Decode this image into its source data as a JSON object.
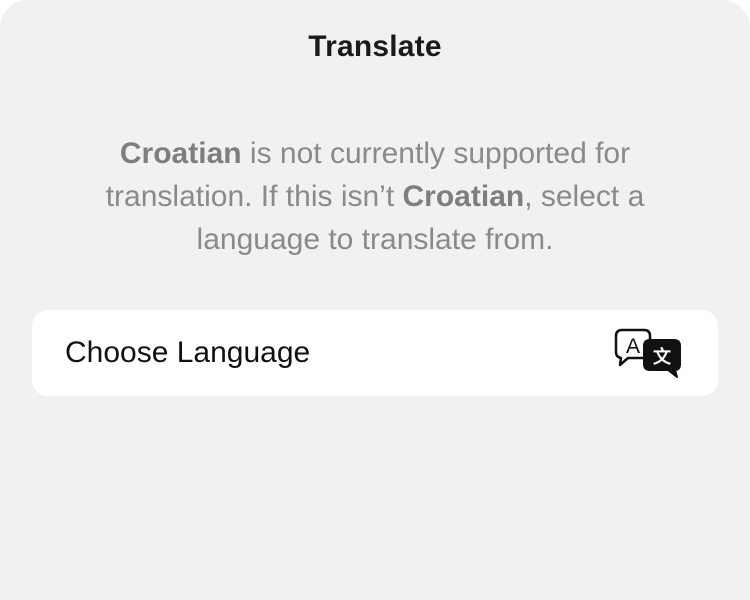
{
  "sheet": {
    "title": "Translate"
  },
  "message": {
    "lang_1": "Croatian",
    "text_1": " is not currently supported for translation. If this isn’t ",
    "lang_2": "Croatian",
    "text_2": ", select a language to translate from."
  },
  "choose_language": {
    "label": "Choose Language",
    "icon": "translate-icon",
    "icon_glyph_latin": "A",
    "icon_glyph_cjk": "文"
  }
}
